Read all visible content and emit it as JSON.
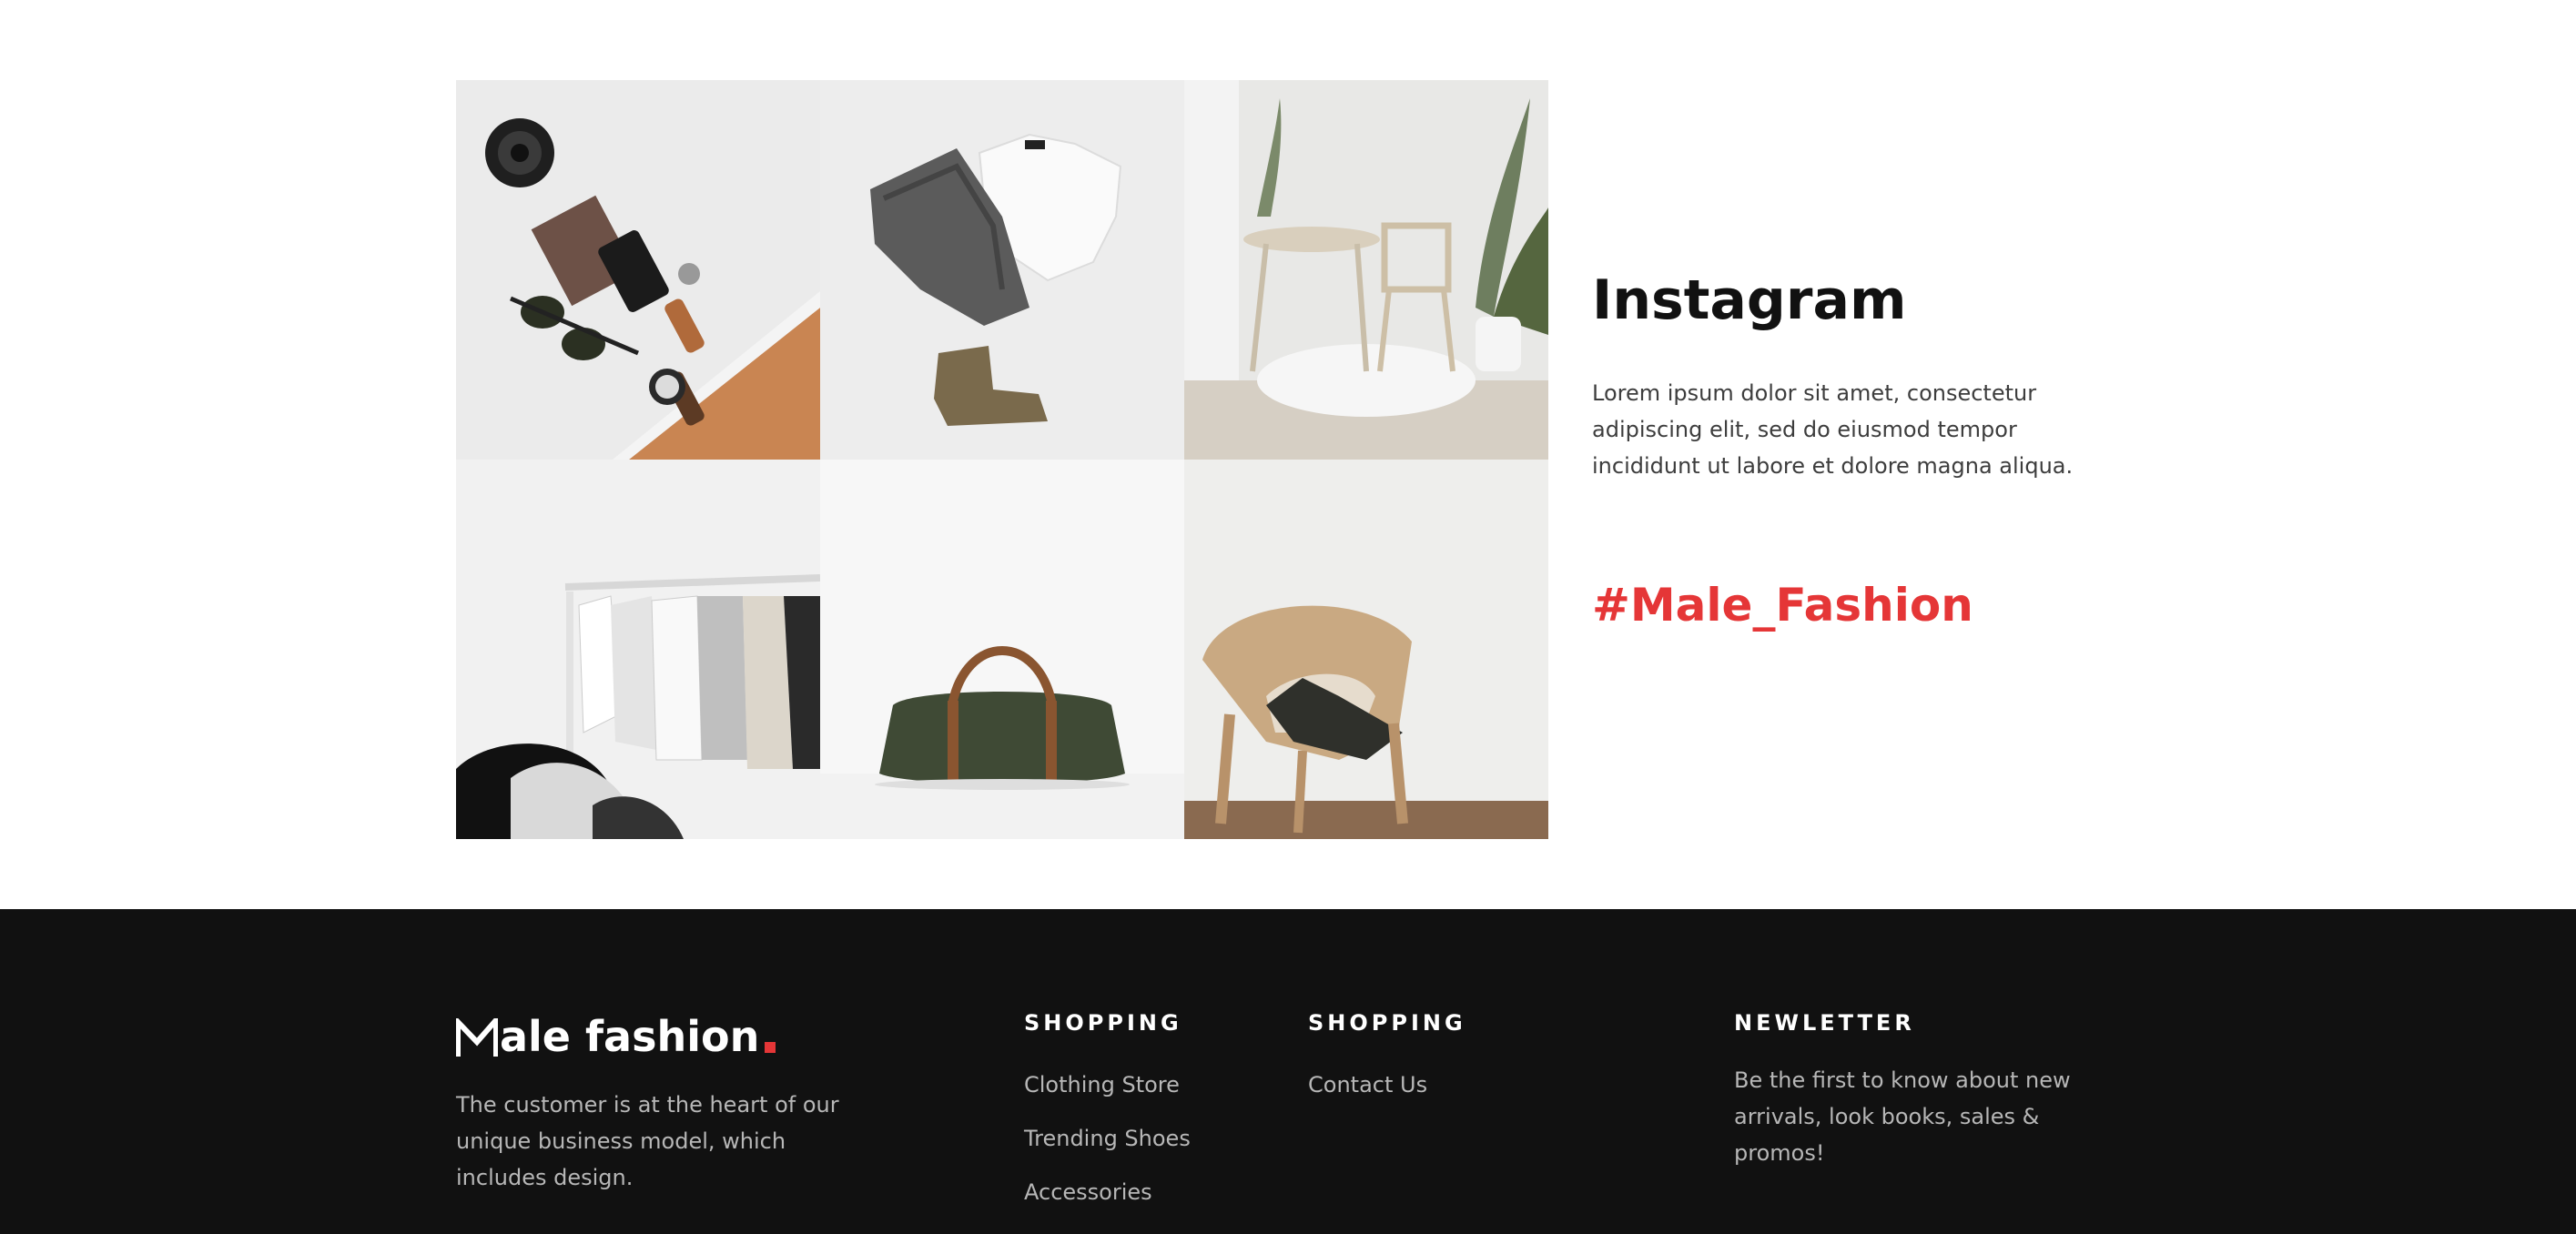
{
  "instagram": {
    "title": "Instagram",
    "description": "Lorem ipsum dolor sit amet, consectetur adipiscing elit, sed do eiusmod tempor incididunt ut labore et dolore magna aliqua.",
    "hashtag": "#Male_Fashion",
    "accent_color": "#e53637",
    "photos": [
      "flatlay-accessories-photo",
      "folded-jeans-tshirt-boots-photo",
      "interior-table-chair-plant-photo",
      "clothing-rack-photo",
      "duffel-bag-photo",
      "wicker-chair-photo"
    ]
  },
  "footer": {
    "logo": {
      "text": "ale fashion",
      "accent_color": "#e53637"
    },
    "about": "The customer is at the heart of our unique business model, which includes design.",
    "columns": [
      {
        "title": "SHOPPING",
        "links": [
          "Clothing Store",
          "Trending Shoes",
          "Accessories"
        ]
      },
      {
        "title": "SHOPPING",
        "links": [
          "Contact Us"
        ]
      }
    ],
    "newsletter": {
      "title": "NEWLETTER",
      "description": "Be the first to know about new arrivals, look books, sales & promos!"
    }
  }
}
